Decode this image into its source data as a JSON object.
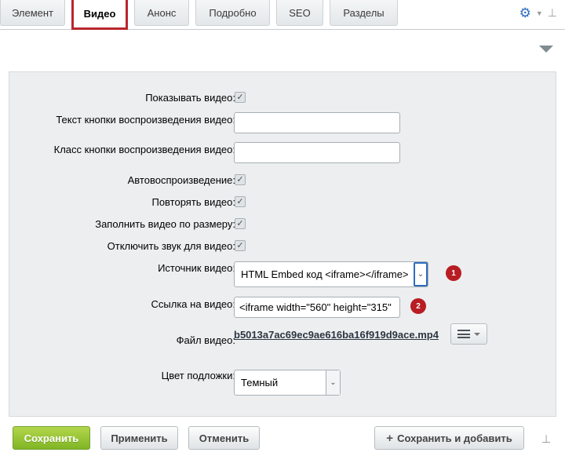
{
  "tabs": [
    {
      "label": "Элемент",
      "active": false
    },
    {
      "label": "Видео",
      "active": true
    },
    {
      "label": "Анонс",
      "active": false
    },
    {
      "label": "Подробно",
      "active": false
    },
    {
      "label": "SEO",
      "active": false
    },
    {
      "label": "Разделы",
      "active": false
    }
  ],
  "icons": {
    "settings": "gear-icon",
    "pin": "pin-icon",
    "collapse": "triangle-down-icon"
  },
  "form": {
    "show_video": {
      "label": "Показывать видео:",
      "checked": true
    },
    "play_button_text": {
      "label": "Текст кнопки воспроизведения видео:",
      "value": ""
    },
    "play_button_class": {
      "label": "Класс кнопки воспроизведения видео:",
      "value": ""
    },
    "autoplay": {
      "label": "Автовоспроизведение:",
      "checked": true
    },
    "loop": {
      "label": "Повторять видео:",
      "checked": true
    },
    "fill": {
      "label": "Заполнить видео по размеру:",
      "checked": true
    },
    "mute": {
      "label": "Отключить звук для видео:",
      "checked": true
    },
    "source": {
      "label": "Источник видео:",
      "value": "HTML Embed код <iframe></iframe>",
      "badge": "1"
    },
    "link": {
      "label": "Ссылка на видео:",
      "value": "<iframe width=\"560\" height=\"315\"",
      "badge": "2"
    },
    "file": {
      "label": "Файл видео:",
      "value": "b5013a7ac69ec9ae616ba16f919d9ace.mp4"
    },
    "bg_color": {
      "label": "Цвет подложки:",
      "value": "Темный"
    }
  },
  "footer": {
    "save": "Сохранить",
    "apply": "Применить",
    "cancel": "Отменить",
    "save_add": "Сохранить и добавить"
  },
  "colors": {
    "accent_red": "#b8262c",
    "primary_green": "#8cbf2e",
    "link_blue": "#2f6dbd"
  }
}
